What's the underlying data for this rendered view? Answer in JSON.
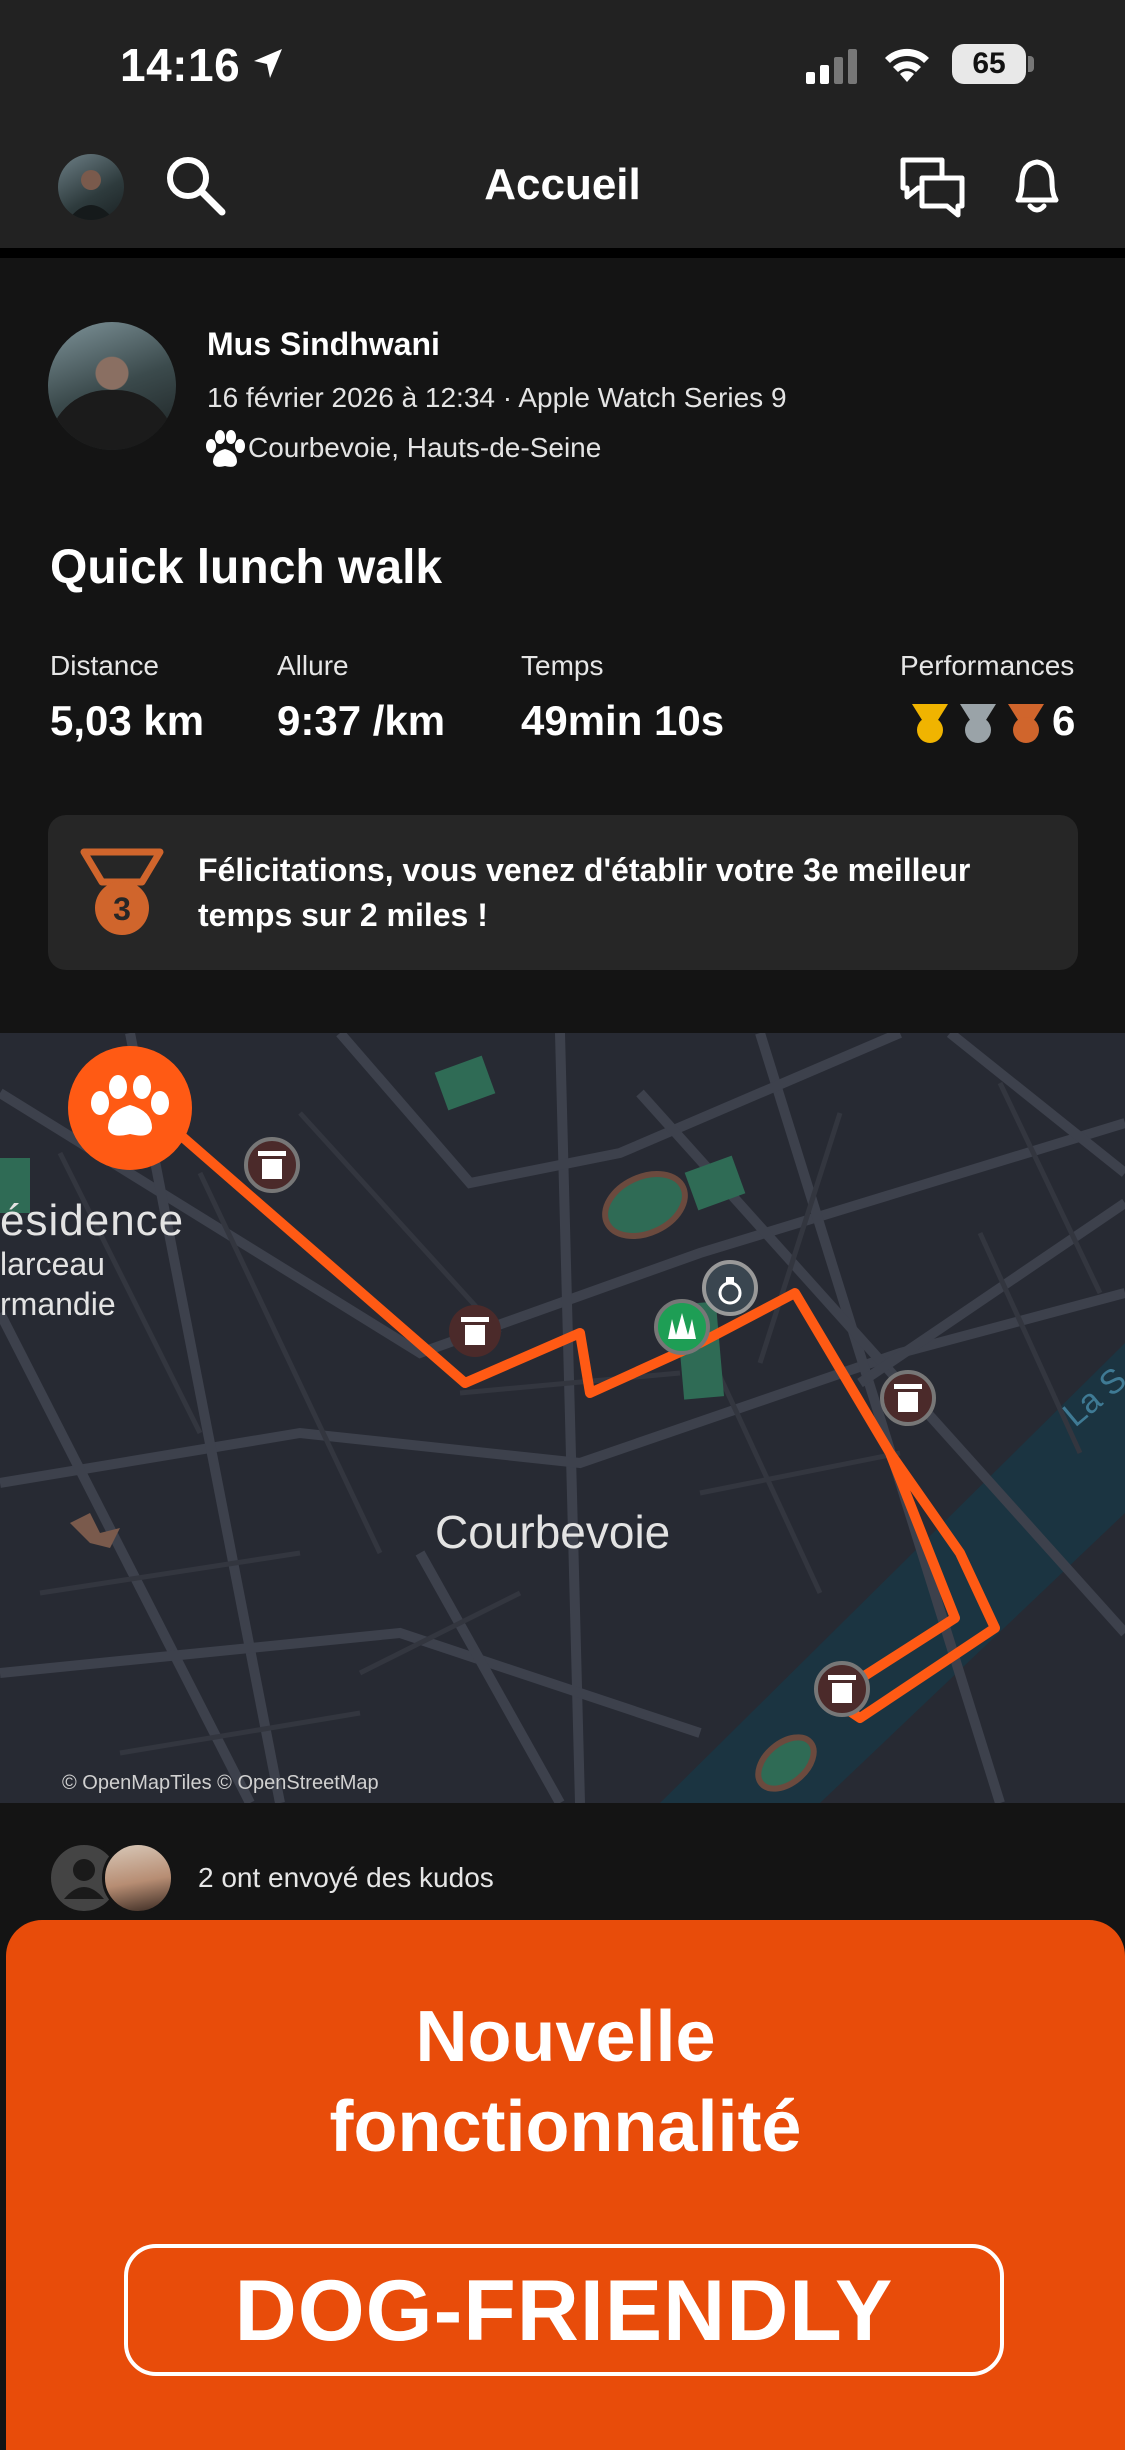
{
  "status_bar": {
    "time": "14:16",
    "battery": "65"
  },
  "header": {
    "title": "Accueil",
    "icons": [
      "avatar",
      "search-icon",
      "chat-icon",
      "bell-icon"
    ]
  },
  "activity": {
    "athlete_name": "Mus Sindhwani",
    "meta": "16 février 2026 à 12:34 · Apple Watch Series 9",
    "location": "Courbevoie, Hauts-de-Seine",
    "title": "Quick lunch walk",
    "stats": {
      "distance_label": "Distance",
      "distance_value": "5,03 km",
      "pace_label": "Allure",
      "pace_value": "9:37 /km",
      "time_label": "Temps",
      "time_value": "49min 10s",
      "perf_label": "Performances",
      "perf_value": "6"
    },
    "achievement": "Félicitations, vous venez d'établir votre 3e meilleur temps sur 2 miles !",
    "achievement_rank": "3"
  },
  "map": {
    "labels": {
      "residence_1": "ésidence",
      "residence_2": "larceau",
      "residence_3": "rmandie",
      "city": "Courbevoie",
      "river": "La S"
    },
    "attribution": "© OpenMapTiles © OpenStreetMap",
    "route_color": "#ff5a14"
  },
  "kudos": {
    "text": "2 ont envoyé des kudos"
  },
  "promo": {
    "title_line1": "Nouvelle",
    "title_line2": "fonctionnalité",
    "button": "DOG-FRIENDLY",
    "color": "#e84c0a"
  }
}
